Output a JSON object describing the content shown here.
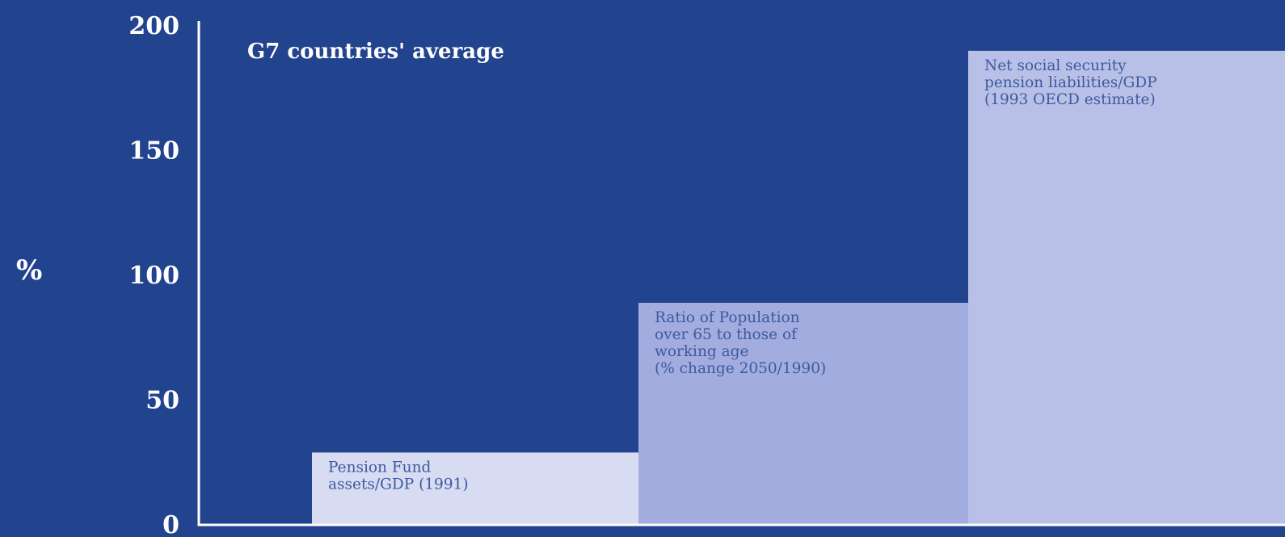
{
  "chart_data": {
    "type": "bar",
    "title": "G7 countries' average",
    "ylabel": "%",
    "ylim": [
      0,
      200
    ],
    "yticks": [
      "0",
      "50",
      "100",
      "150",
      "200"
    ],
    "series": [
      {
        "label_lines": [
          "Pension Fund",
          "assets/GDP (1991)"
        ],
        "value": 29,
        "color": "#d7dcf3"
      },
      {
        "label_lines": [
          "Ratio of Population",
          "over 65 to those of",
          "working age",
          "(% change 2050/1990)"
        ],
        "value": 89,
        "color": "#a2acdf"
      },
      {
        "label_lines": [
          "Net social security",
          "pension liabilities/GDP",
          "(1993 OECD estimate)"
        ],
        "value": 190,
        "color": "#b9c0e8"
      }
    ]
  },
  "colors": {
    "background": "#22438e",
    "axis": "#ffffff",
    "label_text": "#3e5a9e"
  }
}
